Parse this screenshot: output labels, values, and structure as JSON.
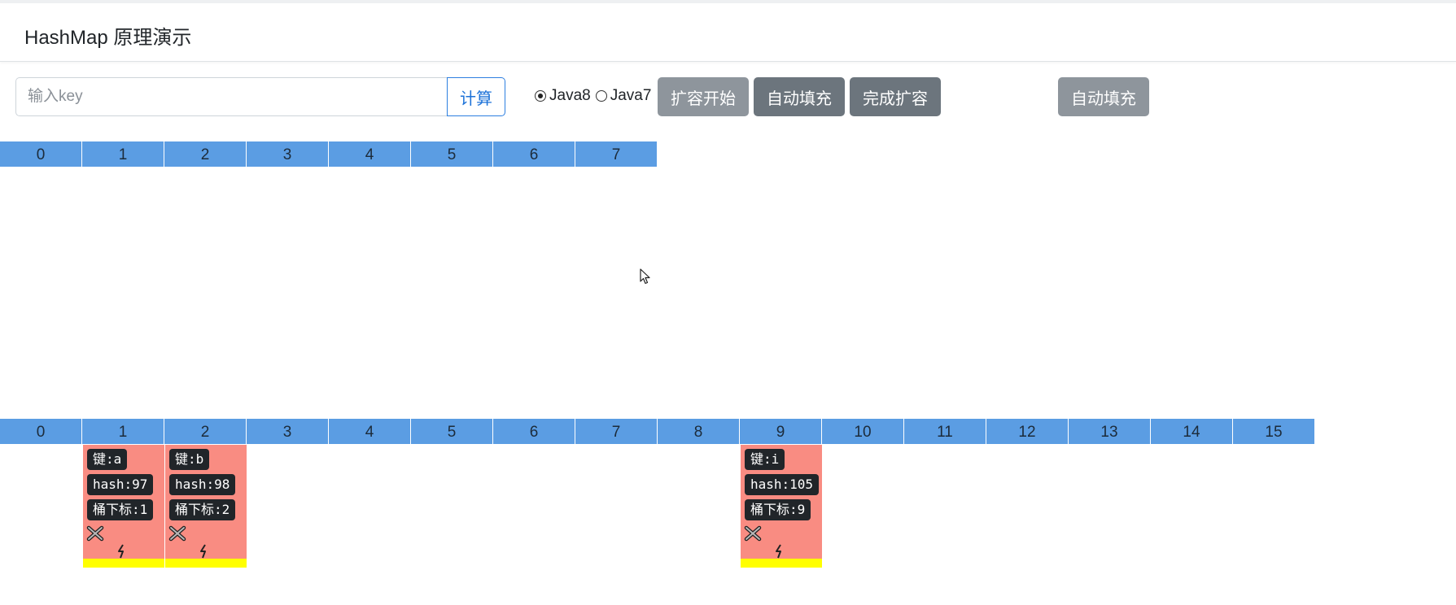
{
  "header": {
    "title": "HashMap 原理演示"
  },
  "controls": {
    "key_placeholder": "输入key",
    "calc_label": "计算",
    "radio_java8": "Java8",
    "radio_java7": "Java7",
    "selected_version": "Java8",
    "expand_start_label": "扩容开始",
    "auto_fill_label": "自动填充",
    "finish_expand_label": "完成扩容",
    "auto_fill_right_label": "自动填充"
  },
  "old_table": {
    "indices": [
      "0",
      "1",
      "2",
      "3",
      "4",
      "5",
      "6",
      "7"
    ]
  },
  "new_table": {
    "indices": [
      "0",
      "1",
      "2",
      "3",
      "4",
      "5",
      "6",
      "7",
      "8",
      "9",
      "10",
      "11",
      "12",
      "13",
      "14",
      "15"
    ]
  },
  "nodes": [
    {
      "bucket": 1,
      "key": "键:a",
      "hash": "hash:97",
      "index": "桶下标:1"
    },
    {
      "bucket": 2,
      "key": "键:b",
      "hash": "hash:98",
      "index": "桶下标:2"
    },
    {
      "bucket": 9,
      "key": "键:i",
      "hash": "hash:105",
      "index": "桶下标:9"
    }
  ],
  "icons": {
    "node_tool": "cross-tools-icon",
    "node_link": "lightning-icon",
    "pointer": "mouse-cursor-icon"
  },
  "colors": {
    "cell": "#5b9de3",
    "node": "#f98c82",
    "node_bar": "#ffff00",
    "button_dark": "#6c757d",
    "button_light": "#8e959c",
    "calc_border": "#2d7fe0"
  }
}
